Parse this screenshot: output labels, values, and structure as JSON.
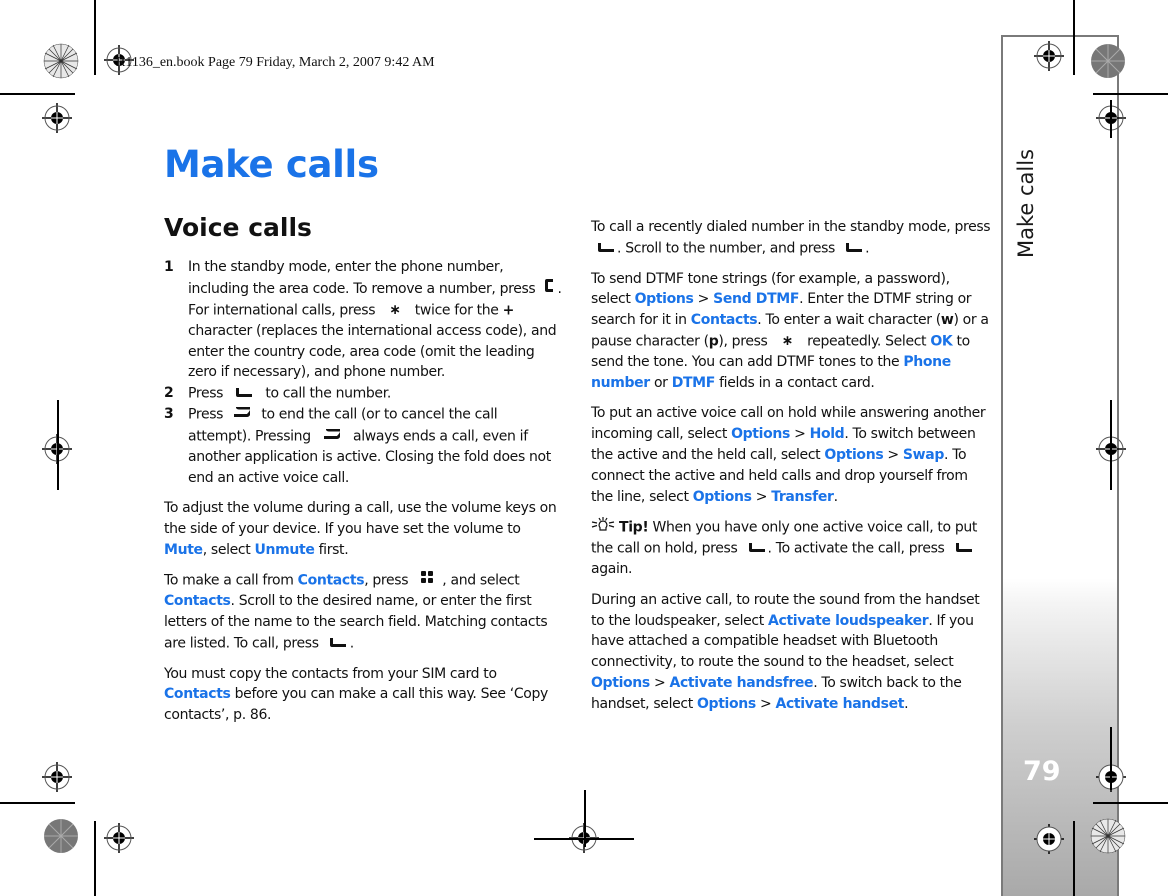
{
  "print_slug": "R1136_en.book  Page 79  Friday, March 2, 2007  9:42 AM",
  "side_tab": {
    "title": "Make calls",
    "page_number": "79"
  },
  "page_title": "Make calls",
  "section_title": "Voice calls",
  "colors": {
    "accent": "#1a73e8",
    "text": "#111111",
    "tab_border": "#7a7a7a"
  },
  "icons": {
    "clear_key": "clear-key-icon",
    "star_key": "star-key-icon",
    "call_key": "call-key-icon",
    "end_key": "end-key-icon",
    "menu_key": "menu-key-icon",
    "tip": "lightbulb-tip-icon"
  },
  "left": {
    "steps": [
      {
        "num": "1",
        "t1": "In the standby mode, enter the phone number, including the area code. To remove a number, press",
        "t2": ". For international calls, press",
        "t3": "twice for the",
        "plus": "+",
        "t4": "character (replaces the international access code), and enter the country code, area code (omit the leading zero if necessary), and phone number."
      },
      {
        "num": "2",
        "t1": "Press",
        "t2": "to call the number."
      },
      {
        "num": "3",
        "t1": "Press",
        "t2": "to end the call (or to cancel the call attempt). Pressing",
        "t3": "always ends a call, even if another application is active. Closing the fold does not end an active voice call."
      }
    ],
    "p_volume": {
      "t1": "To adjust the volume during a call, use the volume keys on the side of your device. If you have set the volume to",
      "k1": "Mute",
      "t2": ", select",
      "k2": "Unmute",
      "t3": "first."
    },
    "p_contacts": {
      "t1": "To make a call from",
      "k1": "Contacts",
      "t2": ", press",
      "t3": ", and select",
      "k2": "Contacts",
      "t4": ". Scroll to the desired name, or enter the first letters of the name to the search field. Matching contacts are listed. To call, press",
      "t5": "."
    },
    "p_sim": {
      "t1": "You must copy the contacts from your SIM card to",
      "k1": "Contacts",
      "t2": "before you can make a call this way. See ‘Copy contacts’, p. 86."
    }
  },
  "right": {
    "p_redial": {
      "t1": "To call a recently dialed number in the standby mode, press",
      "t2": ". Scroll to the number, and press",
      "t3": "."
    },
    "p_dtmf": {
      "t1": "To send DTMF tone strings (for example, a password), select",
      "k1": "Options",
      "sep1": ">",
      "k2": "Send DTMF",
      "t2": ". Enter the DTMF string or search for it in",
      "k3": "Contacts",
      "t3": ". To enter a wait character (",
      "w": "w",
      "t4": ") or a pause character (",
      "p": "p",
      "t5": "), press",
      "t6": "repeatedly. Select",
      "k4": "OK",
      "t7": "to send the tone. You can add DTMF tones to the",
      "k5": "Phone number",
      "t8": "or",
      "k6": "DTMF",
      "t9": "fields in a contact card."
    },
    "p_hold": {
      "t1": "To put an active voice call on hold while answering another incoming call, select",
      "k1": "Options",
      "sep1": ">",
      "k2": "Hold",
      "t2": ". To switch between the active and the held call, select",
      "k3": "Options",
      "sep2": ">",
      "k4": "Swap",
      "t3": ". To connect the active and held calls and drop yourself from the line, select",
      "k5": "Options",
      "sep3": ">",
      "k6": "Transfer",
      "t4": "."
    },
    "p_tip": {
      "label": "Tip!",
      "t1": "When you have only one active voice call, to put the call on hold, press",
      "t2": ". To activate the call, press",
      "t3": "again."
    },
    "p_loud": {
      "t1": "During an active call, to route the sound from the handset to the loudspeaker, select",
      "k1": "Activate loudspeaker",
      "t2": ". If you have attached a compatible headset with Bluetooth connectivity, to route the sound to the headset, select",
      "k2": "Options",
      "sep1": ">",
      "k3": "Activate handsfree",
      "t3": ". To switch back to the handset, select",
      "k4": "Options",
      "sep2": ">",
      "k5": "Activate handset",
      "t4": "."
    }
  }
}
